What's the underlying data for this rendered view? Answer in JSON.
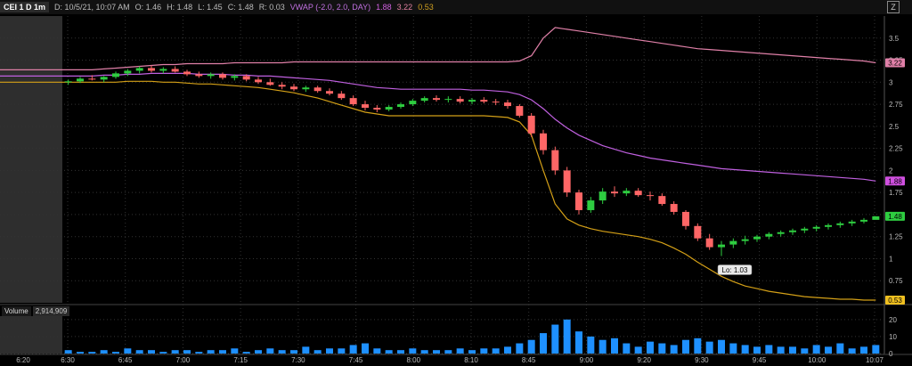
{
  "header": {
    "symbol_label": "CEI 1 D 1m",
    "date_label": "D: 10/5/21, 10:07 AM",
    "open_label": "O: 1.46",
    "high_label": "H: 1.48",
    "low_label": "L: 1.45",
    "close_label": "C: 1.48",
    "range_label": "R: 0.03",
    "vwap_label": "VWAP (-2.0, 2.0, DAY)",
    "vwap_value": "1.88",
    "upper_value": "3.22",
    "lower_value": "0.53",
    "zoom_icon": "zoom-icon"
  },
  "volume_panel": {
    "title": "Volume",
    "value": "2,914,909"
  },
  "colors": {
    "up": "#2ecc40",
    "down": "#ff6666",
    "vwap": "#c060e0",
    "upper_band": "#e080a8",
    "lower_band": "#d4a017",
    "volume": "#1e90ff",
    "grid": "#333333",
    "premarket_shade": "#2e2e2e"
  },
  "chart_data": [
    {
      "type": "candlestick",
      "name": "price",
      "ylim": [
        0.5,
        3.75
      ],
      "y_ticks": [
        0.75,
        1,
        1.25,
        1.5,
        1.75,
        2,
        2.25,
        2.5,
        2.75,
        3,
        3.25,
        3.5
      ],
      "y_tick_labels": [
        "0.75",
        "1",
        "1.25",
        "1.5",
        "1.75",
        "2",
        "2.25",
        "2.5",
        "2.75",
        "3",
        "3.25",
        "3.5"
      ],
      "x_tick_labels": [
        "6:20",
        "6:30",
        "6:45",
        "7:00",
        "7:15",
        "7:30",
        "7:45",
        "8:00",
        "8:10",
        "8:45",
        "9:00",
        "9:20",
        "9:30",
        "9:45",
        "10:00",
        "10:07"
      ],
      "last_price": "1.48",
      "annotation": "Lo: 1.03",
      "annotation_value": 1.03,
      "candles": [
        [
          3.0,
          3.03,
          2.97,
          3.01
        ],
        [
          3.01,
          3.06,
          2.99,
          3.04
        ],
        [
          3.04,
          3.08,
          3.02,
          3.03
        ],
        [
          3.03,
          3.07,
          3.0,
          3.06
        ],
        [
          3.06,
          3.12,
          3.04,
          3.1
        ],
        [
          3.1,
          3.15,
          3.07,
          3.13
        ],
        [
          3.13,
          3.18,
          3.1,
          3.16
        ],
        [
          3.16,
          3.19,
          3.11,
          3.13
        ],
        [
          3.13,
          3.17,
          3.1,
          3.15
        ],
        [
          3.15,
          3.18,
          3.11,
          3.12
        ],
        [
          3.12,
          3.14,
          3.07,
          3.09
        ],
        [
          3.09,
          3.12,
          3.05,
          3.07
        ],
        [
          3.07,
          3.11,
          3.04,
          3.09
        ],
        [
          3.09,
          3.11,
          3.03,
          3.05
        ],
        [
          3.05,
          3.09,
          3.02,
          3.07
        ],
        [
          3.07,
          3.09,
          3.01,
          3.03
        ],
        [
          3.03,
          3.06,
          2.98,
          3.0
        ],
        [
          3.0,
          3.04,
          2.96,
          2.97
        ],
        [
          2.97,
          3.0,
          2.92,
          2.95
        ],
        [
          2.95,
          2.98,
          2.9,
          2.92
        ],
        [
          2.92,
          2.96,
          2.89,
          2.94
        ],
        [
          2.94,
          2.96,
          2.88,
          2.9
        ],
        [
          2.9,
          2.93,
          2.85,
          2.87
        ],
        [
          2.87,
          2.9,
          2.8,
          2.82
        ],
        [
          2.82,
          2.85,
          2.73,
          2.75
        ],
        [
          2.75,
          2.79,
          2.68,
          2.71
        ],
        [
          2.71,
          2.74,
          2.66,
          2.69
        ],
        [
          2.69,
          2.74,
          2.67,
          2.72
        ],
        [
          2.72,
          2.77,
          2.7,
          2.75
        ],
        [
          2.75,
          2.81,
          2.73,
          2.79
        ],
        [
          2.79,
          2.84,
          2.77,
          2.82
        ],
        [
          2.82,
          2.85,
          2.78,
          2.8
        ],
        [
          2.8,
          2.84,
          2.77,
          2.81
        ],
        [
          2.81,
          2.84,
          2.76,
          2.78
        ],
        [
          2.78,
          2.82,
          2.75,
          2.8
        ],
        [
          2.8,
          2.83,
          2.76,
          2.78
        ],
        [
          2.78,
          2.81,
          2.74,
          2.77
        ],
        [
          2.77,
          2.8,
          2.7,
          2.73
        ],
        [
          2.73,
          2.75,
          2.6,
          2.62
        ],
        [
          2.62,
          2.65,
          2.38,
          2.42
        ],
        [
          2.42,
          2.46,
          2.18,
          2.23
        ],
        [
          2.23,
          2.27,
          1.95,
          2.0
        ],
        [
          2.0,
          2.04,
          1.7,
          1.75
        ],
        [
          1.75,
          1.78,
          1.5,
          1.55
        ],
        [
          1.55,
          1.7,
          1.52,
          1.66
        ],
        [
          1.66,
          1.8,
          1.62,
          1.76
        ],
        [
          1.76,
          1.82,
          1.7,
          1.74
        ],
        [
          1.74,
          1.8,
          1.71,
          1.77
        ],
        [
          1.77,
          1.8,
          1.7,
          1.72
        ],
        [
          1.72,
          1.76,
          1.66,
          1.71
        ],
        [
          1.71,
          1.74,
          1.6,
          1.62
        ],
        [
          1.62,
          1.65,
          1.5,
          1.53
        ],
        [
          1.53,
          1.55,
          1.33,
          1.37
        ],
        [
          1.37,
          1.4,
          1.2,
          1.23
        ],
        [
          1.23,
          1.28,
          1.1,
          1.13
        ],
        [
          1.13,
          1.2,
          1.03,
          1.16
        ],
        [
          1.16,
          1.23,
          1.12,
          1.2
        ],
        [
          1.2,
          1.26,
          1.16,
          1.22
        ],
        [
          1.22,
          1.27,
          1.19,
          1.25
        ],
        [
          1.25,
          1.3,
          1.22,
          1.28
        ],
        [
          1.28,
          1.32,
          1.25,
          1.3
        ],
        [
          1.3,
          1.34,
          1.27,
          1.32
        ],
        [
          1.32,
          1.36,
          1.29,
          1.34
        ],
        [
          1.34,
          1.38,
          1.31,
          1.36
        ],
        [
          1.36,
          1.4,
          1.33,
          1.38
        ],
        [
          1.38,
          1.42,
          1.35,
          1.4
        ],
        [
          1.4,
          1.44,
          1.37,
          1.42
        ],
        [
          1.42,
          1.46,
          1.4,
          1.44
        ],
        [
          1.44,
          1.48,
          1.45,
          1.48
        ]
      ],
      "series": [
        {
          "name": "upper_band",
          "values": [
            3.14,
            3.14,
            3.14,
            3.15,
            3.16,
            3.17,
            3.18,
            3.19,
            3.2,
            3.2,
            3.21,
            3.21,
            3.21,
            3.21,
            3.22,
            3.22,
            3.22,
            3.22,
            3.22,
            3.23,
            3.23,
            3.23,
            3.23,
            3.23,
            3.23,
            3.23,
            3.23,
            3.23,
            3.23,
            3.23,
            3.23,
            3.23,
            3.23,
            3.23,
            3.23,
            3.23,
            3.23,
            3.23,
            3.24,
            3.3,
            3.5,
            3.62,
            3.6,
            3.58,
            3.56,
            3.54,
            3.52,
            3.5,
            3.48,
            3.46,
            3.44,
            3.42,
            3.4,
            3.38,
            3.37,
            3.36,
            3.35,
            3.34,
            3.33,
            3.32,
            3.31,
            3.3,
            3.29,
            3.28,
            3.27,
            3.26,
            3.25,
            3.24,
            3.22
          ]
        },
        {
          "name": "vwap",
          "values": [
            3.07,
            3.07,
            3.07,
            3.08,
            3.08,
            3.09,
            3.09,
            3.1,
            3.1,
            3.1,
            3.1,
            3.09,
            3.09,
            3.09,
            3.08,
            3.08,
            3.07,
            3.07,
            3.06,
            3.05,
            3.04,
            3.03,
            3.02,
            3.0,
            2.98,
            2.96,
            2.94,
            2.93,
            2.92,
            2.92,
            2.92,
            2.92,
            2.92,
            2.92,
            2.91,
            2.91,
            2.9,
            2.89,
            2.86,
            2.8,
            2.7,
            2.58,
            2.48,
            2.4,
            2.34,
            2.28,
            2.24,
            2.2,
            2.17,
            2.14,
            2.12,
            2.1,
            2.08,
            2.06,
            2.04,
            2.02,
            2.01,
            2.0,
            1.99,
            1.98,
            1.97,
            1.96,
            1.95,
            1.94,
            1.93,
            1.92,
            1.91,
            1.9,
            1.88
          ]
        },
        {
          "name": "lower_band",
          "values": [
            3.0,
            3.0,
            3.0,
            3.0,
            3.0,
            3.01,
            3.01,
            3.01,
            3.0,
            3.0,
            2.99,
            2.98,
            2.98,
            2.97,
            2.96,
            2.95,
            2.94,
            2.92,
            2.9,
            2.88,
            2.85,
            2.82,
            2.78,
            2.74,
            2.7,
            2.66,
            2.64,
            2.62,
            2.62,
            2.62,
            2.62,
            2.62,
            2.62,
            2.62,
            2.62,
            2.62,
            2.61,
            2.6,
            2.55,
            2.4,
            2.0,
            1.62,
            1.45,
            1.38,
            1.34,
            1.31,
            1.29,
            1.27,
            1.25,
            1.22,
            1.18,
            1.12,
            1.05,
            0.96,
            0.88,
            0.8,
            0.74,
            0.69,
            0.66,
            0.63,
            0.61,
            0.59,
            0.57,
            0.56,
            0.55,
            0.54,
            0.54,
            0.53,
            0.53
          ]
        }
      ]
    },
    {
      "type": "bar",
      "name": "volume",
      "ylim": [
        0,
        22
      ],
      "y_ticks": [
        0,
        10,
        20
      ],
      "y_tick_labels": [
        "0",
        "10",
        "20"
      ],
      "values": [
        2,
        1,
        1,
        2,
        1,
        3,
        2,
        2,
        1,
        2,
        2,
        1,
        2,
        2,
        3,
        1,
        2,
        3,
        2,
        2,
        4,
        2,
        3,
        3,
        5,
        6,
        3,
        2,
        2,
        3,
        2,
        2,
        2,
        3,
        2,
        3,
        3,
        4,
        6,
        8,
        12,
        17,
        20,
        13,
        10,
        8,
        9,
        6,
        4,
        7,
        6,
        5,
        8,
        9,
        7,
        8,
        6,
        5,
        4,
        5,
        4,
        4,
        3,
        5,
        4,
        6,
        3,
        4,
        5
      ]
    }
  ]
}
